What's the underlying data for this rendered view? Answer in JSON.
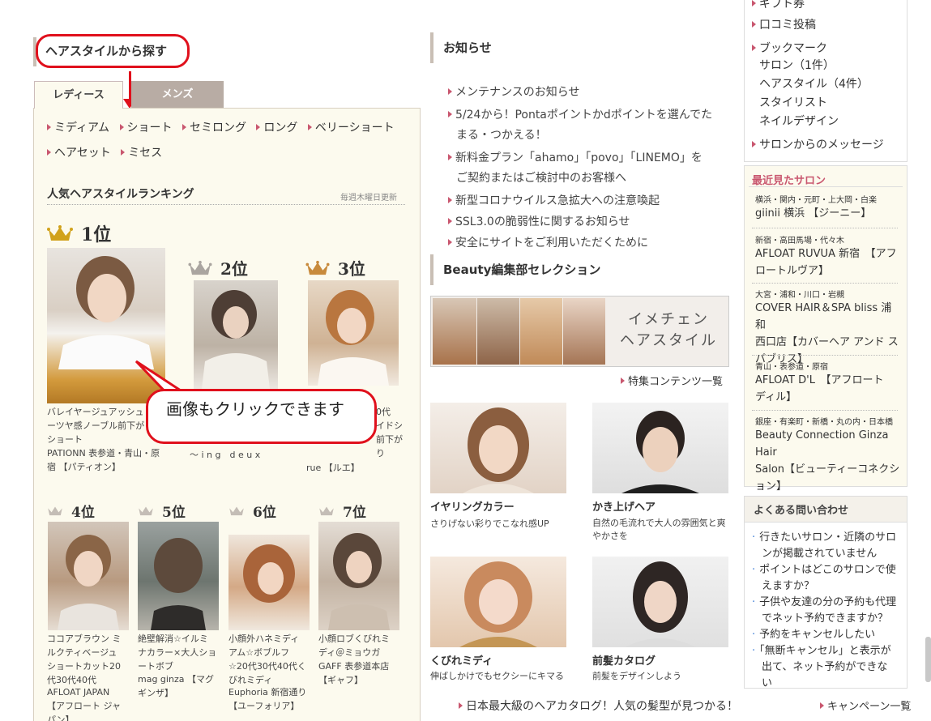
{
  "left": {
    "section_title": "ヘアスタイルから探す",
    "tabs": [
      "レディース",
      "メンズ"
    ],
    "categories": [
      "ミディアム",
      "ショート",
      "セミロング",
      "ロング",
      "ベリーショート",
      "ヘアセット",
      "ミセス"
    ],
    "ranking_title": "人気ヘアスタイルランキング",
    "ranking_update": "毎週木曜日更新",
    "callout": "画像もクリックできます",
    "ranks": [
      {
        "label": "1位",
        "caption": "バレイヤージュアッシュ\nーツヤ感ノーブル前下が\nショート",
        "salon": "PATIONN 表参道・青山・原\n宿 【パティオン】"
      },
      {
        "label": "2位",
        "caption": "",
        "salon": "～ i n g　d e u x"
      },
      {
        "label": "3位",
        "caption": "0代\nイドシ\n前下が\nり",
        "salon": "rue 【ルエ】"
      },
      {
        "label": "4位",
        "caption": "ココアブラウン ミ\nルクティベージュ\nショートカット20\n代30代40代",
        "salon": "AFLOAT JAPAN\n【アフロート ジャ\nパン】"
      },
      {
        "label": "5位",
        "caption": "絶壁解消☆イルミ\nナカラー×大人ショ\nートボブ",
        "salon": "mag ginza 【マグ\nギンザ】"
      },
      {
        "label": "6位",
        "caption": "小顔外ハネミディ\nアム☆ボブルフ\n☆20代30代40代く\nびれミディ",
        "salon": "Euphoria 新宿通り\n【ユーフォリア】"
      },
      {
        "label": "7位",
        "caption": "小顔ロブくびれミ\nディ＠ミョウガ",
        "salon": "GAFF 表参道本店\n【ギャフ】"
      }
    ]
  },
  "middle": {
    "news_title": "お知らせ",
    "news": [
      "メンテナンスのお知らせ",
      "5/24から！Pontaポイントかdポイントを選んでた\nまる・つかえる！",
      "新料金プラン「ahamo」「povo」「LINEMO」を\nご契約またはご検討中のお客様へ",
      "新型コロナウイルス急拡大への注意喚起",
      "SSL3.0の脆弱性に関するお知らせ",
      "安全にサイトをご利用いただくために"
    ],
    "beauty_title": "Beauty編集部セレクション",
    "banner_text": [
      "イメチェン",
      "ヘアスタイル"
    ],
    "feature_link": "特集コンテンツ一覧",
    "features": [
      {
        "title": "イヤリングカラー",
        "sub": "さりげない彩りでこなれ感UP"
      },
      {
        "title": "かき上げヘア",
        "sub": "自然の毛流れで大人の雰囲気と爽\nやかさを"
      },
      {
        "title": "くびれミディ",
        "sub": "伸ばしかけでもセクシーにキマる"
      },
      {
        "title": "前髪カタログ",
        "sub": "前髪をデザインしよう"
      }
    ],
    "bottom_link": "日本最大級のヘアカタログ！人気の髪型が見つかる！"
  },
  "right": {
    "top_links": [
      "ギフト券",
      "口コミ投稿",
      "ブックマーク"
    ],
    "bookmark_subs": [
      "サロン（1件）",
      "ヘアスタイル（4件）",
      "スタイリスト",
      "ネイルデザイン"
    ],
    "salon_message": "サロンからのメッセージ",
    "recent_title": "最近見たサロン",
    "recent": [
      {
        "area": "横浜・関内・元町・上大岡・白楽",
        "name": "giinii 横浜 【ジーニー】"
      },
      {
        "area": "新宿・高田馬場・代々木",
        "name": "AFLOAT RUVUA 新宿　【アフ\nロートルヴア】"
      },
      {
        "area": "大宮・浦和・川口・岩槻",
        "name": "COVER HAIR＆SPA bliss 浦和\n西口店【カバーヘア アンド ス\nパブリス】"
      },
      {
        "area": "青山・表参道・原宿",
        "name": "AFLOAT D'L　【アフロート\nディル】"
      },
      {
        "area": "銀座・有楽町・新橋・丸の内・日本橋",
        "name": "Beauty Connection Ginza Hair\nSalon【ビューティーコネクシ\nョン】"
      }
    ],
    "faq_title": "よくある問い合わせ",
    "faq": [
      "行きたいサロン・近隣のサロ\nンが掲載されていません",
      "ポイントはどこのサロンで使\nえますか？",
      "子供や友達の分の予約も代理\nでネット予約できますか？",
      "予約をキャンセルしたい",
      "「無断キャンセル」と表示が\n出て、ネット予約ができない"
    ],
    "campaign_link": "キャンペーン一覧"
  }
}
